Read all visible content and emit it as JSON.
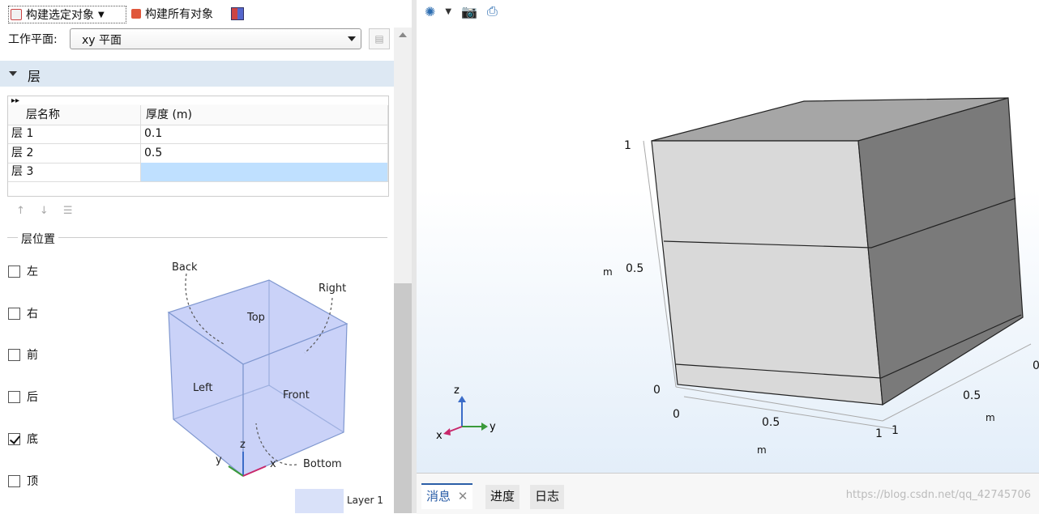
{
  "toolbar": {
    "build_selected": "构建选定对象",
    "build_all": "构建所有对象"
  },
  "workplane": {
    "label": "工作平面:",
    "value": "xy 平面"
  },
  "section": {
    "title": "层"
  },
  "layers_table": {
    "columns": [
      "层名称",
      "厚度 (m)"
    ],
    "rows": [
      {
        "name": "层 1",
        "thickness": "0.1"
      },
      {
        "name": "层 2",
        "thickness": "0.5"
      },
      {
        "name": "层 3",
        "thickness": ""
      }
    ]
  },
  "layer_position": {
    "title": "层位置",
    "options": [
      {
        "label": "左",
        "checked": false
      },
      {
        "label": "右",
        "checked": false
      },
      {
        "label": "前",
        "checked": false
      },
      {
        "label": "后",
        "checked": false
      },
      {
        "label": "底",
        "checked": true
      },
      {
        "label": "顶",
        "checked": false
      }
    ]
  },
  "figure": {
    "labels": {
      "back": "Back",
      "right": "Right",
      "top": "Top",
      "left": "Left",
      "front": "Front",
      "bottom": "Bottom",
      "z": "z",
      "y": "y",
      "x": "x",
      "layer1": "Layer 1"
    }
  },
  "graphics": {
    "axis_labels": {
      "z_ticks": [
        "1",
        "0.5",
        "0"
      ],
      "z_unit": "m",
      "x_ticks": [
        "0",
        "0.5",
        "1"
      ],
      "x_unit": "m",
      "y_ticks": [
        "0",
        "0.5",
        "1"
      ],
      "y_unit": "m"
    },
    "triad": {
      "z": "z",
      "y": "y",
      "x": "x"
    }
  },
  "bottom_tabs": [
    {
      "label": "消息",
      "active": true
    },
    {
      "label": "进度",
      "active": false
    },
    {
      "label": "日志",
      "active": false
    }
  ],
  "watermark": "https://blog.csdn.net/qq_42745706",
  "colors": {
    "selected_cell": "#bfe0ff",
    "section_bg": "#dde8f3",
    "cube_light": "#d9d9d9",
    "cube_dark": "#7a7a7a",
    "cube_top": "#a6a6a6"
  }
}
